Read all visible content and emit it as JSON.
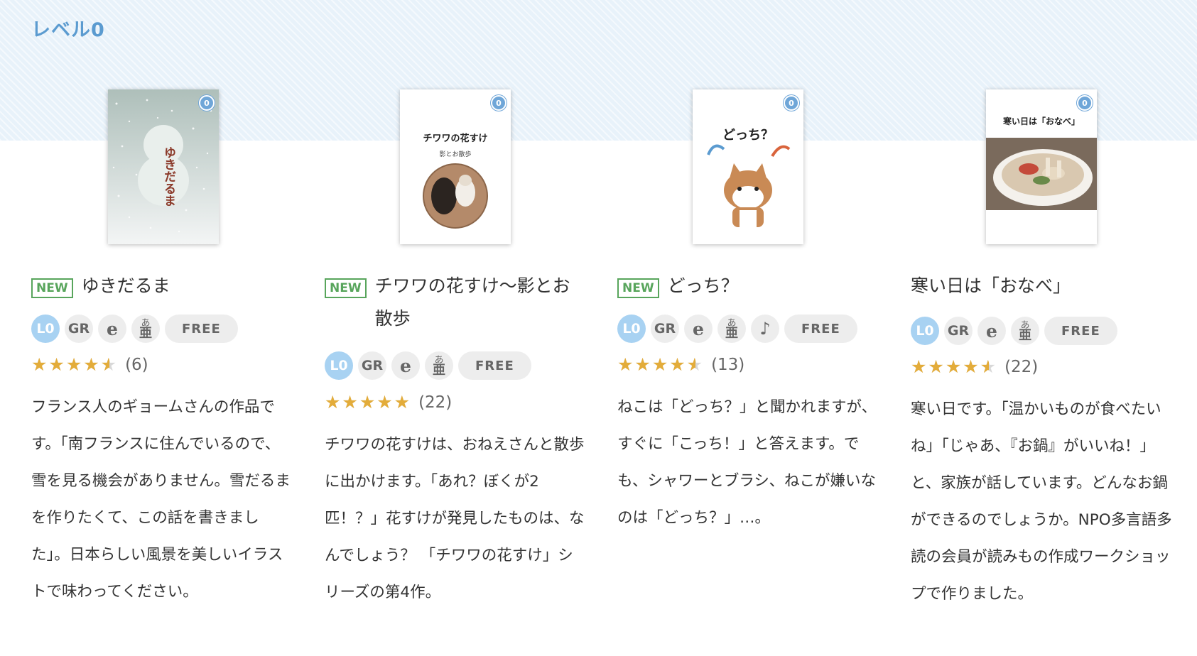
{
  "section": {
    "title": "レベル0"
  },
  "books": [
    {
      "cover_title": "ゆきだるま",
      "cover_level": "0",
      "new_label": "NEW",
      "title": "ゆきだるま",
      "tags": {
        "level": "L0",
        "gr": "GR",
        "e": "e",
        "kana_top": "あ",
        "kana_bottom": "亜",
        "music": "",
        "free": "FREE"
      },
      "rating_value": 4.5,
      "rating_count": "(6)",
      "description": "フランス人のギョームさんの作品です。「南フランスに住んでいるので、雪を見る機会がありません。雪だるまを作りたくて、この話を書きました」。日本らしい風景を美しいイラストで味わってください。"
    },
    {
      "cover_title": "チワワの花すけ",
      "cover_subtitle": "影とお散歩",
      "cover_level": "0",
      "new_label": "NEW",
      "title": "チワワの花すけ〜影とお散歩",
      "tags": {
        "level": "L0",
        "gr": "GR",
        "e": "e",
        "kana_top": "あ",
        "kana_bottom": "亜",
        "music": "",
        "free": "FREE"
      },
      "rating_value": 5,
      "rating_count": "(22)",
      "description": "チワワの花すけは、おねえさんと散歩に出かけます。「あれ？ぼくが2匹！？」花すけが発見したものは、なんでしょう？ 「チワワの花すけ」シリーズの第4作。"
    },
    {
      "cover_title": "どっち？",
      "cover_level": "0",
      "new_label": "NEW",
      "title": "どっち？",
      "tags": {
        "level": "L0",
        "gr": "GR",
        "e": "e",
        "kana_top": "あ",
        "kana_bottom": "亜",
        "music": "♪",
        "free": "FREE"
      },
      "rating_value": 4.5,
      "rating_count": "(13)",
      "description": "ねこは「どっち？」と聞かれますが、すぐに「こっち！」と答えます。でも、シャワーとブラシ、ねこが嫌いなのは「どっち？」…。"
    },
    {
      "cover_title": "寒い日は「おなべ」",
      "cover_level": "0",
      "new_label": "",
      "title": "寒い日は「おなべ」",
      "tags": {
        "level": "L0",
        "gr": "GR",
        "e": "e",
        "kana_top": "あ",
        "kana_bottom": "亜",
        "music": "",
        "free": "FREE"
      },
      "rating_value": 4.5,
      "rating_count": "(22)",
      "description": "寒い日です。「温かいものが食べたいね」「じゃあ、『お鍋』がいいね！」と、家族が話しています。どんなお鍋ができるのでしょうか。NPO多言語多読の会員が読みもの作成ワークショップで作りました。"
    }
  ],
  "colors": {
    "accent": "#5b9bd0",
    "new_badge": "#58a55c",
    "star": "#e3ac3a",
    "level_tag": "#a8d2f2"
  }
}
